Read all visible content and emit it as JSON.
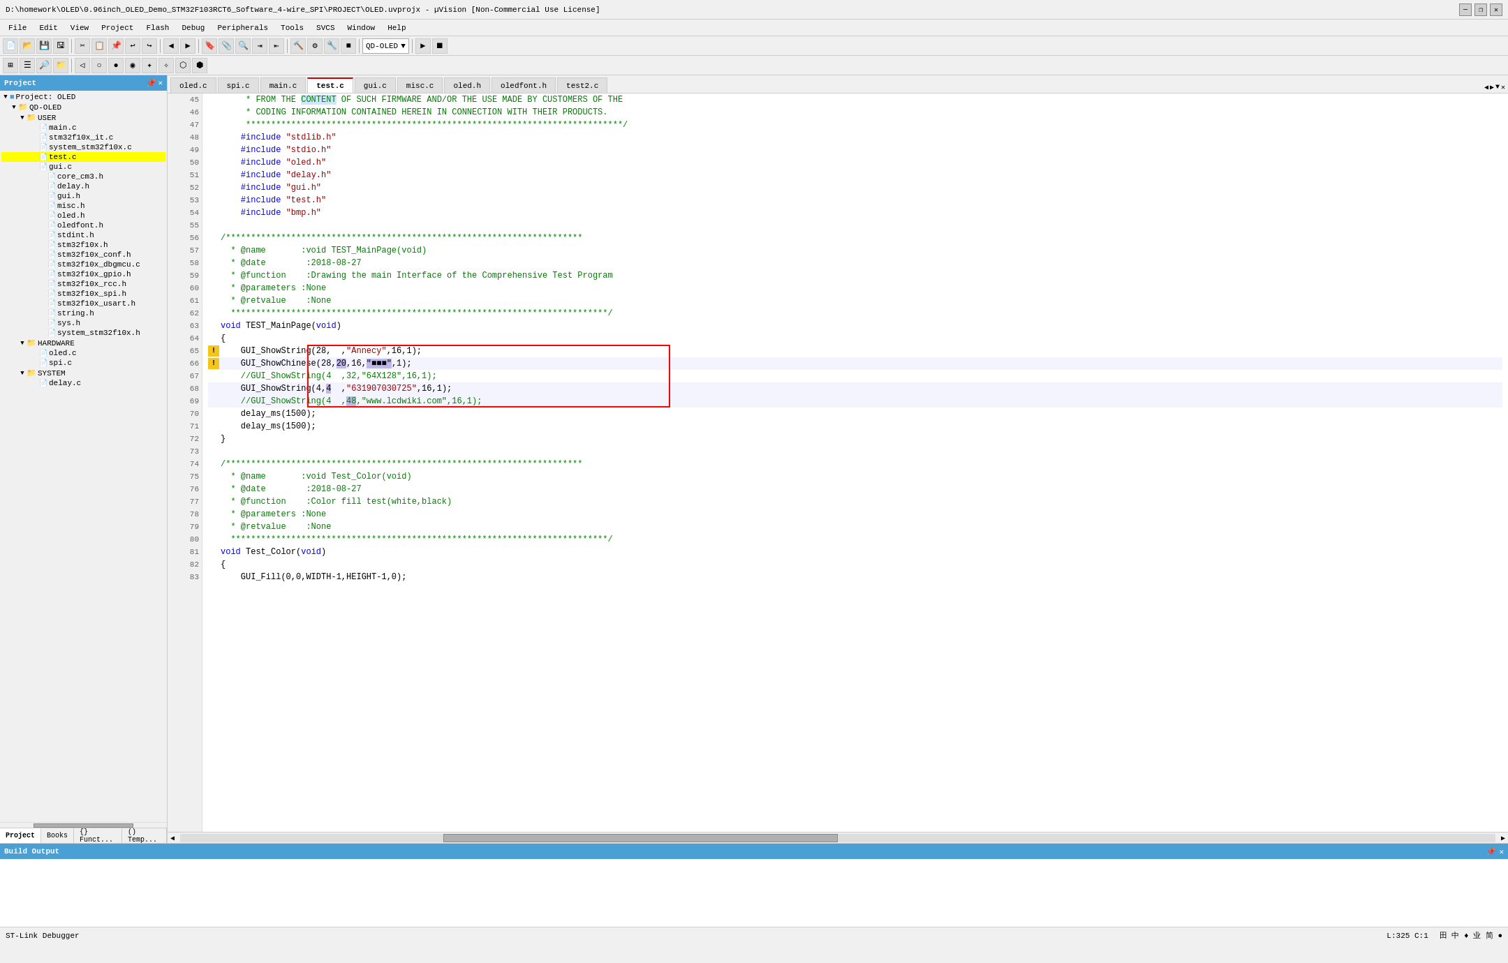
{
  "titlebar": {
    "title": "D:\\homework\\OLED\\0.96inch_OLED_Demo_STM32F103RCT6_Software_4-wire_SPI\\PROJECT\\OLED.uvprojx - µVision  [Non-Commercial Use License]",
    "min": "—",
    "max": "❐",
    "close": "✕"
  },
  "menubar": {
    "items": [
      "File",
      "Edit",
      "View",
      "Project",
      "Flash",
      "Debug",
      "Peripherals",
      "Tools",
      "SVCS",
      "Window",
      "Help"
    ]
  },
  "left_panel": {
    "header": "Project",
    "close_btn": "✕",
    "project_label": "Project: OLED",
    "tree": [
      {
        "id": "project-root",
        "label": "Project: OLED",
        "indent": 0,
        "type": "project",
        "expand": "▼"
      },
      {
        "id": "qd-oled",
        "label": "QD-OLED",
        "indent": 1,
        "type": "folder",
        "expand": "▼"
      },
      {
        "id": "user",
        "label": "USER",
        "indent": 2,
        "type": "folder",
        "expand": "▼"
      },
      {
        "id": "main-c",
        "label": "main.c",
        "indent": 3,
        "type": "file"
      },
      {
        "id": "stm32f10x-it",
        "label": "stm32f10x_it.c",
        "indent": 3,
        "type": "file"
      },
      {
        "id": "system-stm32",
        "label": "system_stm32f10x.c",
        "indent": 3,
        "type": "file"
      },
      {
        "id": "test-c",
        "label": "test.c",
        "indent": 3,
        "type": "file",
        "active": true
      },
      {
        "id": "gui-c-tree",
        "label": "gui.c",
        "indent": 3,
        "type": "file"
      },
      {
        "id": "core-cm3",
        "label": "core_cm3.h",
        "indent": 4,
        "type": "file"
      },
      {
        "id": "delay-h",
        "label": "delay.h",
        "indent": 4,
        "type": "file"
      },
      {
        "id": "gui-h",
        "label": "gui.h",
        "indent": 4,
        "type": "file"
      },
      {
        "id": "misc-h",
        "label": "misc.h",
        "indent": 4,
        "type": "file"
      },
      {
        "id": "oled-h-tree",
        "label": "oled.h",
        "indent": 4,
        "type": "file"
      },
      {
        "id": "oledfont-h-tree",
        "label": "oledfont.h",
        "indent": 4,
        "type": "file"
      },
      {
        "id": "stdint-h",
        "label": "stdint.h",
        "indent": 4,
        "type": "file"
      },
      {
        "id": "stm32f10x-h",
        "label": "stm32f10x.h",
        "indent": 4,
        "type": "file"
      },
      {
        "id": "stm32f10x-conf",
        "label": "stm32f10x_conf.h",
        "indent": 4,
        "type": "file"
      },
      {
        "id": "stm32f10x-dbgmcu",
        "label": "stm32f10x_dbgmcu.c",
        "indent": 4,
        "type": "file"
      },
      {
        "id": "stm32f10x-gpio",
        "label": "stm32f10x_gpio.h",
        "indent": 4,
        "type": "file"
      },
      {
        "id": "stm32f10x-rcc",
        "label": "stm32f10x_rcc.h",
        "indent": 4,
        "type": "file"
      },
      {
        "id": "stm32f10x-spi",
        "label": "stm32f10x_spi.h",
        "indent": 4,
        "type": "file"
      },
      {
        "id": "stm32f10x-usart",
        "label": "stm32f10x_usart.h",
        "indent": 4,
        "type": "file"
      },
      {
        "id": "string-h",
        "label": "string.h",
        "indent": 4,
        "type": "file"
      },
      {
        "id": "sys-h",
        "label": "sys.h",
        "indent": 4,
        "type": "file"
      },
      {
        "id": "system-h",
        "label": "system_stm32f10x.h",
        "indent": 4,
        "type": "file"
      },
      {
        "id": "hardware",
        "label": "HARDWARE",
        "indent": 2,
        "type": "folder",
        "expand": "▼"
      },
      {
        "id": "oled-c",
        "label": "oled.c",
        "indent": 3,
        "type": "file"
      },
      {
        "id": "spi-c",
        "label": "spi.c",
        "indent": 3,
        "type": "file"
      },
      {
        "id": "system-folder",
        "label": "SYSTEM",
        "indent": 2,
        "type": "folder",
        "expand": "▼"
      },
      {
        "id": "delay-c",
        "label": "delay.c",
        "indent": 3,
        "type": "file"
      }
    ],
    "tabs": [
      "Project",
      "Books",
      "{} Funct...",
      "() Temp..."
    ]
  },
  "editor": {
    "tabs": [
      {
        "label": "oled.c",
        "active": false
      },
      {
        "label": "spi.c",
        "active": false
      },
      {
        "label": "main.c",
        "active": false
      },
      {
        "label": "test.c",
        "active": true,
        "highlight": true
      },
      {
        "label": "gui.c",
        "active": false
      },
      {
        "label": "misc.c",
        "active": false
      },
      {
        "label": "oled.h",
        "active": false
      },
      {
        "label": "oledfont.h",
        "active": false
      },
      {
        "label": "test2.c",
        "active": false
      }
    ],
    "lines": [
      {
        "num": 45,
        "content": "     * FROM THE CONTENT OF SUCH FIRMWARE AND/OR THE USE MADE BY CUSTOMERS OF THE",
        "type": "comment"
      },
      {
        "num": 46,
        "content": "     * CODING INFORMATION CONTAINED HEREIN IN CONNECTION WITH THEIR PRODUCTS.",
        "type": "comment"
      },
      {
        "num": 47,
        "content": "     ***************************************************************************/",
        "type": "comment"
      },
      {
        "num": 48,
        "content": "    #include \"stdlib.h\"",
        "type": "include"
      },
      {
        "num": 49,
        "content": "    #include \"stdio.h\"",
        "type": "include"
      },
      {
        "num": 50,
        "content": "    #include \"oled.h\"",
        "type": "include"
      },
      {
        "num": 51,
        "content": "    #include \"delay.h\"",
        "type": "include"
      },
      {
        "num": 52,
        "content": "    #include \"gui.h\"",
        "type": "include"
      },
      {
        "num": 53,
        "content": "    #include \"test.h\"",
        "type": "include"
      },
      {
        "num": 54,
        "content": "    #include \"bmp.h\"",
        "type": "include"
      },
      {
        "num": 55,
        "content": "",
        "type": "blank"
      },
      {
        "num": 56,
        "content": "/***********************************************************************",
        "type": "comment"
      },
      {
        "num": 57,
        "content": "  * @name       :void TEST_MainPage(void)",
        "type": "comment"
      },
      {
        "num": 58,
        "content": "  * @date        :2018-08-27",
        "type": "comment"
      },
      {
        "num": 59,
        "content": "  * @function    :Drawing the main Interface of the Comprehensive Test Program",
        "type": "comment"
      },
      {
        "num": 60,
        "content": "  * @parameters :None",
        "type": "comment"
      },
      {
        "num": 61,
        "content": "  * @retvalue    :None",
        "type": "comment"
      },
      {
        "num": 62,
        "content": "  ***************************************************************************/",
        "type": "comment"
      },
      {
        "num": 63,
        "content": "void TEST_MainPage(void)",
        "type": "code"
      },
      {
        "num": 64,
        "content": "{",
        "type": "code"
      },
      {
        "num": 65,
        "content": "    GUI_ShowString(28,  ,\"Annecy\",16,1);",
        "type": "code",
        "warning": true
      },
      {
        "num": 66,
        "content": "    GUI_ShowChinese(28,20,16,\"■■■\",1);",
        "type": "code",
        "warning": true,
        "highlighted": true
      },
      {
        "num": 67,
        "content": "    //GUI_ShowString(4  ,32,\"64X128\",16,1);",
        "type": "code"
      },
      {
        "num": 68,
        "content": "    GUI_ShowString(4,4  ,\"631907030725\",16,1);",
        "type": "code",
        "highlighted": true
      },
      {
        "num": 69,
        "content": "    //GUI_ShowString(4  ,48,\"www.lcdwiki.com\",16,1);",
        "type": "code",
        "highlighted": true
      },
      {
        "num": 70,
        "content": "    delay_ms(1500);",
        "type": "code"
      },
      {
        "num": 71,
        "content": "    delay_ms(1500);",
        "type": "code"
      },
      {
        "num": 72,
        "content": "}",
        "type": "code"
      },
      {
        "num": 73,
        "content": "",
        "type": "blank"
      },
      {
        "num": 74,
        "content": "/***********************************************************************",
        "type": "comment"
      },
      {
        "num": 75,
        "content": "  * @name       :void Test_Color(void)",
        "type": "comment"
      },
      {
        "num": 76,
        "content": "  * @date        :2018-08-27",
        "type": "comment"
      },
      {
        "num": 77,
        "content": "  * @function    :Color fill test(white,black)",
        "type": "comment"
      },
      {
        "num": 78,
        "content": "  * @parameters :None",
        "type": "comment"
      },
      {
        "num": 79,
        "content": "  * @retvalue    :None",
        "type": "comment"
      },
      {
        "num": 80,
        "content": "  ***************************************************************************/",
        "type": "comment"
      },
      {
        "num": 81,
        "content": "void Test_Color(void)",
        "type": "code"
      },
      {
        "num": 82,
        "content": "{",
        "type": "code"
      },
      {
        "num": 83,
        "content": "    GUI_Fill(0,0,WIDTH-1,HEIGHT-1,0);",
        "type": "code"
      }
    ]
  },
  "build_output": {
    "header": "Build Output",
    "content": ""
  },
  "statusbar": {
    "debugger": "ST-Link Debugger",
    "position": "L:325 C:1",
    "lang_icons": "田 中 ♦ 业 简 ●"
  },
  "toolbar_qd_oled": "QD-OLED"
}
